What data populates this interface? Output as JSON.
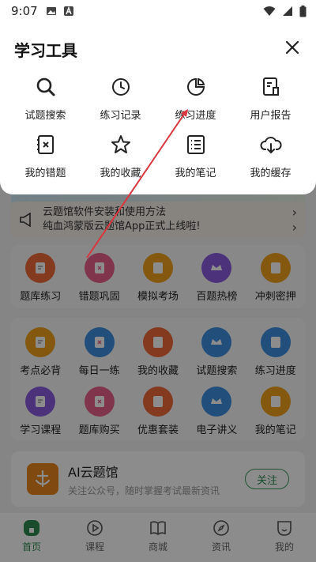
{
  "status_bar": {
    "time": "9:07"
  },
  "tools_panel": {
    "title": "学习工具",
    "tools": [
      {
        "label": "试题搜索",
        "icon": "search-icon"
      },
      {
        "label": "练习记录",
        "icon": "clock-icon"
      },
      {
        "label": "练习进度",
        "icon": "pie-chart-icon"
      },
      {
        "label": "用户报告",
        "icon": "report-icon"
      },
      {
        "label": "我的错题",
        "icon": "wrong-questions-icon"
      },
      {
        "label": "我的收藏",
        "icon": "star-icon"
      },
      {
        "label": "我的笔记",
        "icon": "notes-icon"
      },
      {
        "label": "我的缓存",
        "icon": "cloud-download-icon"
      }
    ]
  },
  "notice": {
    "line1": "云题馆软件安装和使用方法",
    "line2": "纯血鸿蒙版云题馆App正式上线啦!"
  },
  "main_functions": [
    {
      "label": "题库练习",
      "color": "#ef6a3a"
    },
    {
      "label": "错题巩固",
      "color": "#e9628a"
    },
    {
      "label": "模拟考场",
      "color": "#f0a21c"
    },
    {
      "label": "百题热榜",
      "color": "#8a5ce0"
    },
    {
      "label": "冲刺密押",
      "color": "#f0a21c"
    }
  ],
  "more_functions": [
    {
      "label": "考点必背",
      "color": "#f0a21c"
    },
    {
      "label": "每日一练",
      "color": "#3c8fe0"
    },
    {
      "label": "我的收藏",
      "color": "#ef6a3a"
    },
    {
      "label": "试题搜索",
      "color": "#3c8fe0"
    },
    {
      "label": "练习进度",
      "color": "#3c8fe0"
    },
    {
      "label": "学习课程",
      "color": "#8a5ce0"
    },
    {
      "label": "题库购买",
      "color": "#e9628a"
    },
    {
      "label": "优惠套装",
      "color": "#ef6a3a"
    },
    {
      "label": "电子讲义",
      "color": "#3c8fe0"
    },
    {
      "label": "我的笔记",
      "color": "#f0a21c"
    }
  ],
  "ai_card": {
    "title": "AI云题馆",
    "subtitle": "关注公众号，随时掌握考试最新资讯",
    "follow_label": "关注"
  },
  "tab_bar": {
    "tabs": [
      {
        "label": "首页",
        "active": true
      },
      {
        "label": "课程",
        "active": false
      },
      {
        "label": "商城",
        "active": false
      },
      {
        "label": "资讯",
        "active": false
      },
      {
        "label": "我的",
        "active": false
      }
    ]
  },
  "colors": {
    "accent_green": "#2f8a52",
    "annotation_arrow": "#d9363e"
  }
}
